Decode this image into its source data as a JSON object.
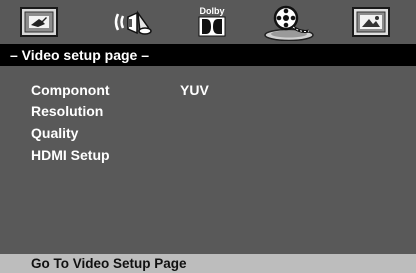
{
  "tabs": [
    {
      "icon": "general-setup-icon",
      "selected": false
    },
    {
      "icon": "audio-setup-icon",
      "selected": false
    },
    {
      "icon": "dolby-digital-setup-icon",
      "label": "Dolby",
      "selected": false
    },
    {
      "icon": "video-setup-icon",
      "selected": true
    },
    {
      "icon": "preference-setup-icon",
      "selected": false
    }
  ],
  "page_title": "– Video setup page –",
  "menu": {
    "items": [
      {
        "label": "Componont",
        "value": "YUV"
      },
      {
        "label": "Resolution"
      },
      {
        "label": "Quality"
      },
      {
        "label": "HDMI Setup"
      }
    ]
  },
  "status": "Go To Video Setup Page",
  "colors": {
    "background": "#595959",
    "title_bar": "#000000",
    "status_bar": "#bdbdbd",
    "text": "#ffffff"
  }
}
